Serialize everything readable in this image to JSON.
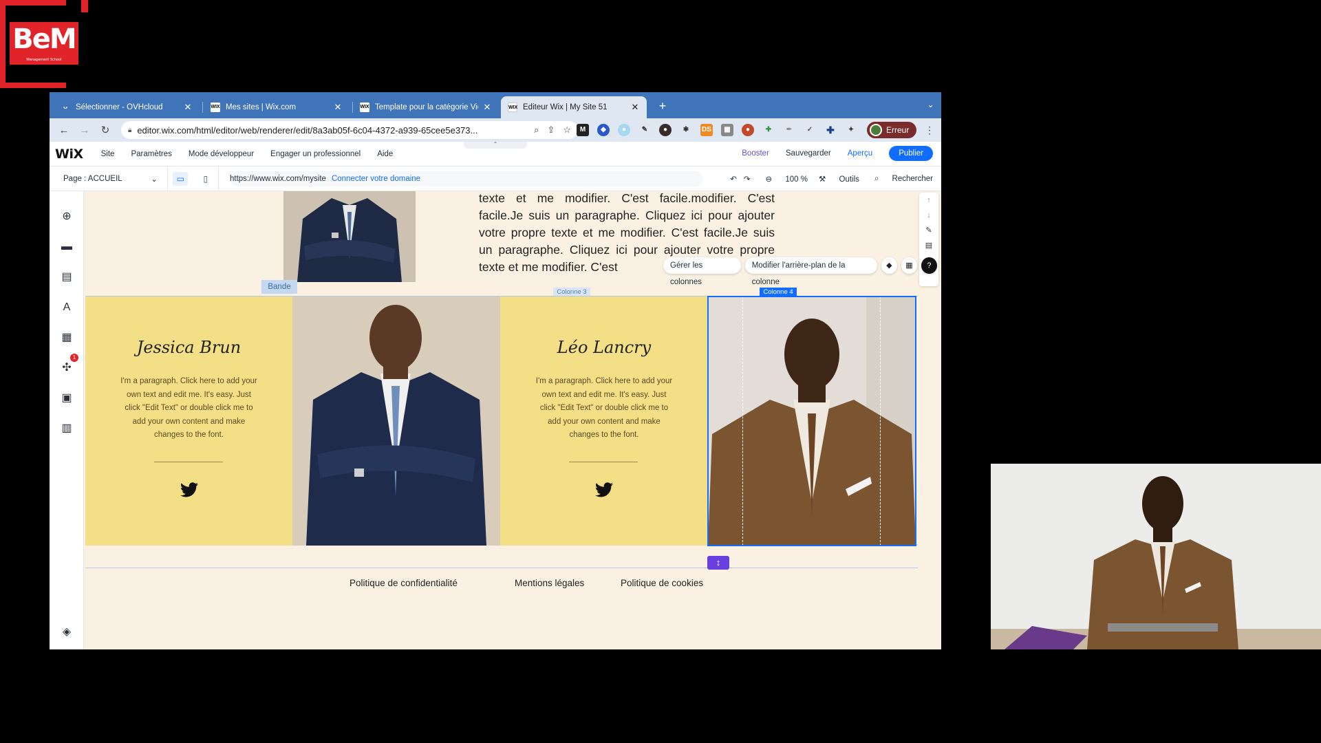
{
  "logo": {
    "text": "BeM",
    "tagline": "Management School"
  },
  "browser": {
    "tabs": [
      {
        "favicon": "ovh",
        "label": "Sélectionner - OVHcloud",
        "active": false
      },
      {
        "favicon": "WIX",
        "label": "Mes sites | Wix.com",
        "active": false
      },
      {
        "favicon": "WIX",
        "label": "Template pour la catégorie Vie",
        "active": false
      },
      {
        "favicon": "WIX",
        "label": "Éditeur Wix | My Site 51",
        "active": true
      }
    ],
    "new_tab": "+",
    "tab_menu": "⌄",
    "url": "editor.wix.com/html/editor/web/renderer/edit/8a3ab05f-6c04-4372-a939-65cee5e373...",
    "profile_label": "Erreur"
  },
  "wix": {
    "logo": "WiX",
    "menu": [
      "Site",
      "Paramètres",
      "Mode développeur",
      "Engager un professionnel",
      "Aide"
    ],
    "right": {
      "booster": "Booster",
      "save": "Sauvegarder",
      "preview": "Aperçu",
      "publish": "Publier"
    },
    "page_selector": "Page : ACCUEIL",
    "site_url": "https://www.wix.com/mysite",
    "connect_domain": "Connecter votre domaine",
    "zoom": "100 %",
    "tools": "Outils",
    "search": "Rechercher"
  },
  "canvas": {
    "top_paragraph": "texte et me modifier. C'est facile.modifier. C'est facile.Je suis un paragraphe. Cliquez ici pour ajouter votre propre texte et me modifier. C'est facile.Je suis un paragraphe. Cliquez ici pour ajouter votre propre texte et me modifier. C'est",
    "column_toolbar": {
      "manage": "Gérer les colonnes",
      "background": "Modifier l'arrière-plan de la colonne"
    },
    "labels": {
      "band": "Bande",
      "col3": "Colonne 3",
      "col4": "Colonne 4"
    },
    "team": [
      {
        "name": "Jessica Brun",
        "paragraph": "I'm a paragraph. Click here to add your own text and edit me. It's easy. Just click \"Edit Text\" or double click me to add your own content and make changes to the font."
      },
      {
        "name": "Léo Lancry",
        "paragraph": "I'm a paragraph. Click here to add your own text and edit me. It's easy. Just click \"Edit Text\" or double click me to add your own content and make changes to the font."
      }
    ],
    "footer_links": [
      "Politique de confidentialité",
      "Mentions légales",
      "Politique de cookies"
    ]
  },
  "colors": {
    "tabbar": "#3f74b8",
    "wix_blue": "#116dff",
    "column_yellow": "#f3df86",
    "canvas_bg": "#faf1e2",
    "logo_red": "#e0242a"
  }
}
